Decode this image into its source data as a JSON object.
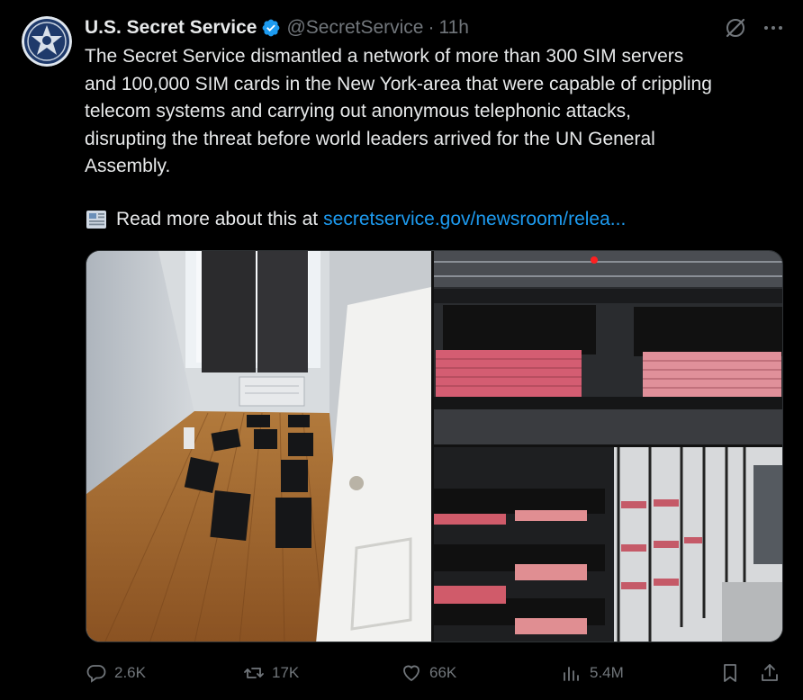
{
  "author": {
    "name": "U.S. Secret Service",
    "handle": "@SecretService",
    "separator": "·",
    "time": "11h",
    "avatar_icon": "secret-service-star-badge",
    "verified_color": "#1d9bf0"
  },
  "tweet": {
    "text": "The Secret Service dismantled a network of more than 300 SIM servers\nand 100,000 SIM cards in the New York-area that were capable of crippling\ntelecom systems and carrying out anonymous telephonic attacks,\ndisrupting the threat before world leaders arrived for the UN General\nAssembly.",
    "read_more_text": "Read more about this at",
    "link_text": "secretservice.gov/newsroom/relea...",
    "link_color": "#1d9bf0"
  },
  "media": {
    "photos": [
      {
        "description_icon": "apartment-room-with-sim-servers"
      },
      {
        "description_icon": "rack-of-sim-servers"
      },
      {
        "description_icon": "shelves-of-sim-servers"
      }
    ]
  },
  "actions": {
    "replies": "2.6K",
    "reposts": "17K",
    "likes": "66K",
    "views": "5.4M"
  },
  "colors": {
    "background": "#000000",
    "text": "#e7e9ea",
    "muted": "#71767b",
    "accent": "#1d9bf0"
  }
}
